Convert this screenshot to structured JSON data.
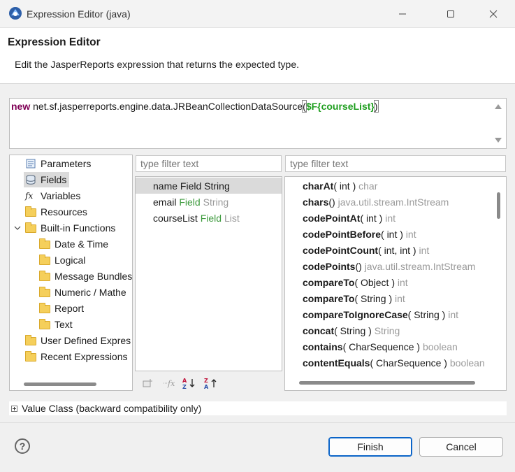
{
  "window": {
    "title": "Expression Editor (java)",
    "minimize_icon": "minimize-icon",
    "maximize_icon": "maximize-icon",
    "close_icon": "close-icon"
  },
  "header": {
    "title": "Expression Editor",
    "description": "Edit the JasperReports expression that returns the expected type."
  },
  "expression": {
    "keyword": "new",
    "class_call": " net.sf.jasperreports.engine.data.JRBeanCollectionDataSource",
    "open_paren": "(",
    "field_ref": "$F{courseList}",
    "close_paren": ")"
  },
  "tree": {
    "items": [
      {
        "label": "Parameters",
        "icon": "parameters-icon"
      },
      {
        "label": "Fields",
        "icon": "fields-icon"
      },
      {
        "label": "Variables",
        "icon": "variables-icon"
      },
      {
        "label": "Resources",
        "icon": "resources-icon"
      },
      {
        "label": "Built-in Functions",
        "icon": "folder-icon"
      },
      {
        "label": "Date & Time",
        "icon": "folder-icon"
      },
      {
        "label": "Logical",
        "icon": "folder-icon"
      },
      {
        "label": "Message Bundles",
        "icon": "folder-icon"
      },
      {
        "label": "Numeric / Mathe",
        "icon": "folder-icon"
      },
      {
        "label": "Report",
        "icon": "folder-icon"
      },
      {
        "label": "Text",
        "icon": "folder-icon"
      },
      {
        "label": "User Defined Expres",
        "icon": "folder-icon"
      },
      {
        "label": "Recent Expressions",
        "icon": "folder-icon"
      }
    ]
  },
  "fields_filter": {
    "placeholder": "type filter text"
  },
  "fields": [
    {
      "name": "name",
      "kind": "Field",
      "type": "String"
    },
    {
      "name": "email",
      "kind": "Field",
      "type": "String"
    },
    {
      "name": "courseList",
      "kind": "Field",
      "type": "List"
    }
  ],
  "methods_filter": {
    "placeholder": "type filter text"
  },
  "methods": [
    {
      "name": "charAt",
      "args": "( int )",
      "ret": "char"
    },
    {
      "name": "chars",
      "args": "()",
      "ret": "java.util.stream.IntStream"
    },
    {
      "name": "codePointAt",
      "args": "( int )",
      "ret": "int"
    },
    {
      "name": "codePointBefore",
      "args": "( int )",
      "ret": "int"
    },
    {
      "name": "codePointCount",
      "args": "( int, int )",
      "ret": "int"
    },
    {
      "name": "codePoints",
      "args": "()",
      "ret": "java.util.stream.IntStream"
    },
    {
      "name": "compareTo",
      "args": "( Object )",
      "ret": "int"
    },
    {
      "name": "compareTo",
      "args": "( String )",
      "ret": "int"
    },
    {
      "name": "compareToIgnoreCase",
      "args": "( String )",
      "ret": "int"
    },
    {
      "name": "concat",
      "args": "( String )",
      "ret": "String"
    },
    {
      "name": "contains",
      "args": "( CharSequence )",
      "ret": "boolean"
    },
    {
      "name": "contentEquals",
      "args": "( CharSequence )",
      "ret": "boolean"
    }
  ],
  "toolbar": {
    "add_icon": "add-field-icon",
    "function_icon": "function-icon",
    "sort_asc_icon": "sort-ascending-icon",
    "sort_desc_icon": "sort-descending-icon"
  },
  "value_class": {
    "label": "Value Class (backward compatibility only)"
  },
  "buttons": {
    "finish": "Finish",
    "cancel": "Cancel",
    "help_icon": "help-icon"
  },
  "colors": {
    "keyword": "#7f0055",
    "field": "#1e9e1e",
    "default_button": "#0b64c8"
  }
}
